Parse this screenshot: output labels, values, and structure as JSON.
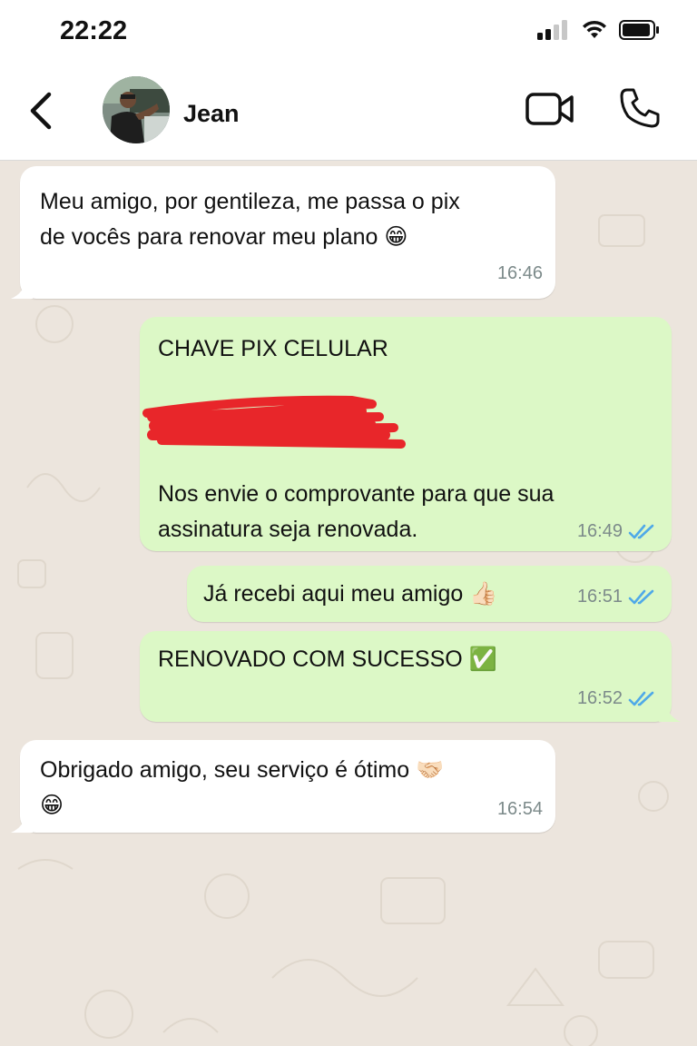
{
  "status_bar": {
    "time": "22:22"
  },
  "header": {
    "contact_name": "Jean"
  },
  "messages": [
    {
      "direction": "in",
      "text": "Meu amigo, por gentileza, me passa o pix\nde vocês para renovar meu plano 😁",
      "time": "16:46"
    },
    {
      "direction": "out",
      "text_top": "CHAVE PIX CELULAR",
      "text_bottom": "Nos envie o comprovante para que sua\nassinatura seja renovada.",
      "time": "16:49",
      "status": "read"
    },
    {
      "direction": "out",
      "text": "Já recebi aqui meu amigo 👍🏻",
      "time": "16:51",
      "status": "read"
    },
    {
      "direction": "out",
      "text": "RENOVADO COM SUCESSO ✅",
      "time": "16:52",
      "status": "read"
    },
    {
      "direction": "in",
      "text": "Obrigado amigo, seu serviço é ótimo 🤝🏻\n😁",
      "time": "16:54"
    }
  ],
  "colors": {
    "incoming_bubble": "#ffffff",
    "outgoing_bubble": "#dcf8c6",
    "read_ticks": "#4fa9e8",
    "redaction": "#e8262a",
    "chat_background": "#ece5dd"
  },
  "icons": {
    "back": "chevron-left-icon",
    "video": "video-camera-icon",
    "call": "phone-icon",
    "signal": "cellular-signal-icon",
    "wifi": "wifi-icon",
    "battery": "battery-icon",
    "read": "double-check-icon"
  }
}
